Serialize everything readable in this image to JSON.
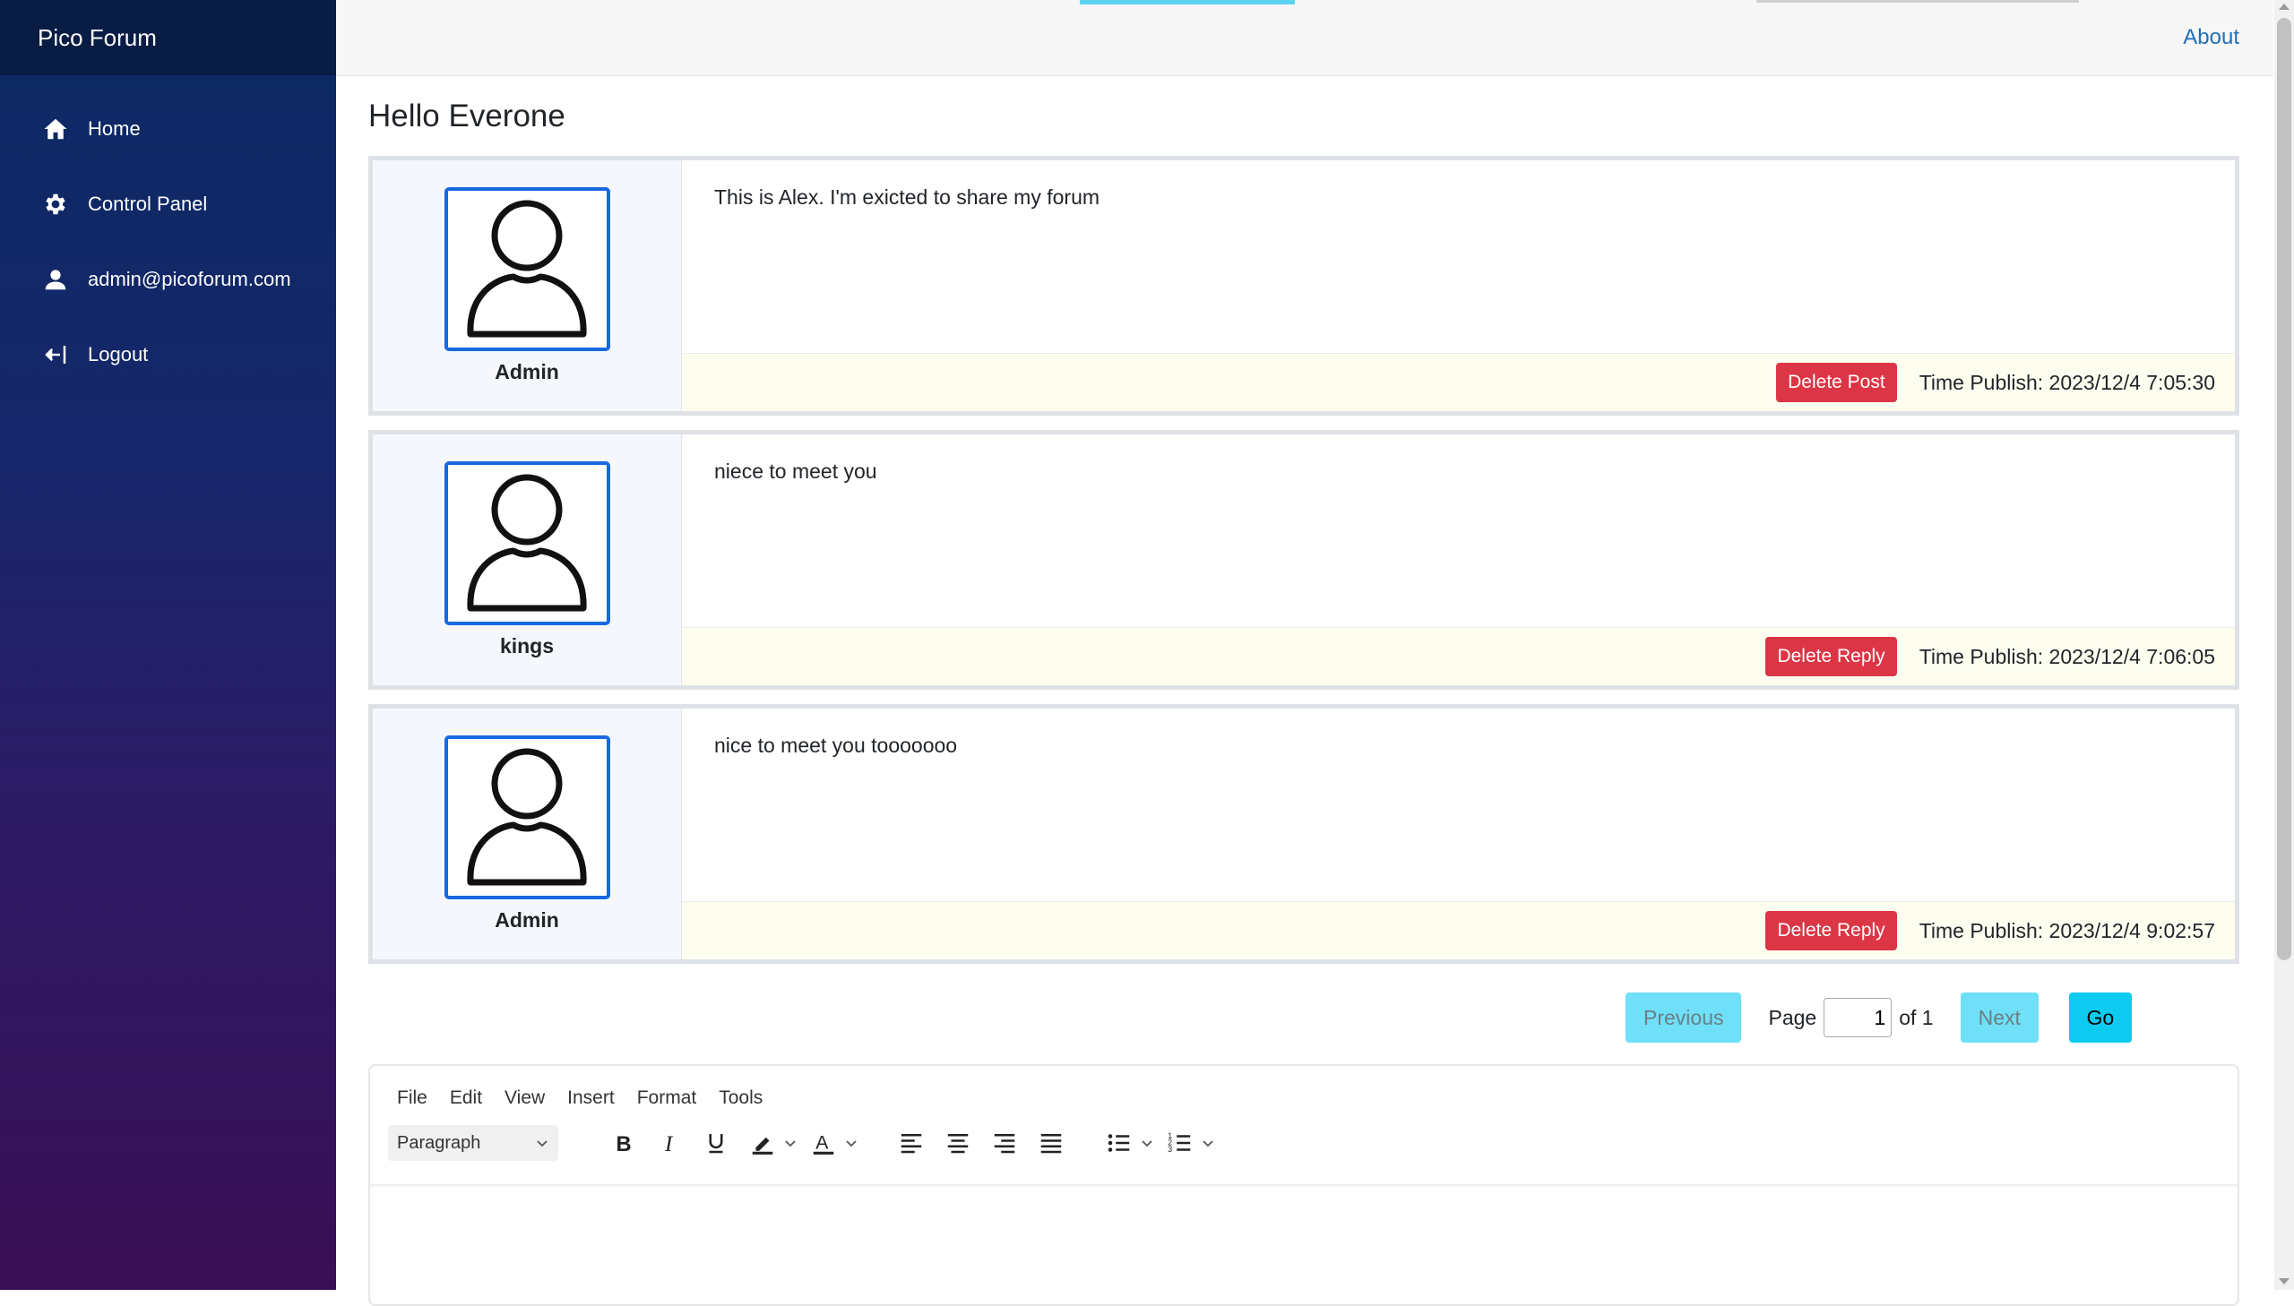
{
  "app": {
    "brand": "Pico Forum"
  },
  "sidebar": {
    "items": [
      {
        "label": "Home",
        "icon": "home-icon"
      },
      {
        "label": "Control Panel",
        "icon": "gear-icon"
      },
      {
        "label": "admin@picoforum.com",
        "icon": "user-icon"
      },
      {
        "label": "Logout",
        "icon": "logout-icon"
      }
    ]
  },
  "topbar": {
    "about_label": "About"
  },
  "page": {
    "title": "Hello Everone"
  },
  "posts": [
    {
      "author": "Admin",
      "content": "This is Alex. I'm exicted to share my forum",
      "action_label": "Delete Post",
      "time": "Time Publish: 2023/12/4 7:05:30"
    },
    {
      "author": "kings",
      "content": "niece to meet you",
      "action_label": "Delete Reply",
      "time": "Time Publish: 2023/12/4 7:06:05"
    },
    {
      "author": "Admin",
      "content": "nice to meet you tooooooo",
      "action_label": "Delete Reply",
      "time": "Time Publish: 2023/12/4 9:02:57"
    }
  ],
  "pagination": {
    "previous_label": "Previous",
    "page_label": "Page",
    "page_value": "1",
    "of_label": "of 1",
    "next_label": "Next",
    "go_label": "Go"
  },
  "editor": {
    "menu": [
      "File",
      "Edit",
      "View",
      "Insert",
      "Format",
      "Tools"
    ],
    "block_format": "Paragraph"
  },
  "colors": {
    "accent": "#1769e0",
    "danger": "#dc3545",
    "info": "#0dcaf0",
    "link": "#1f6fb8"
  }
}
